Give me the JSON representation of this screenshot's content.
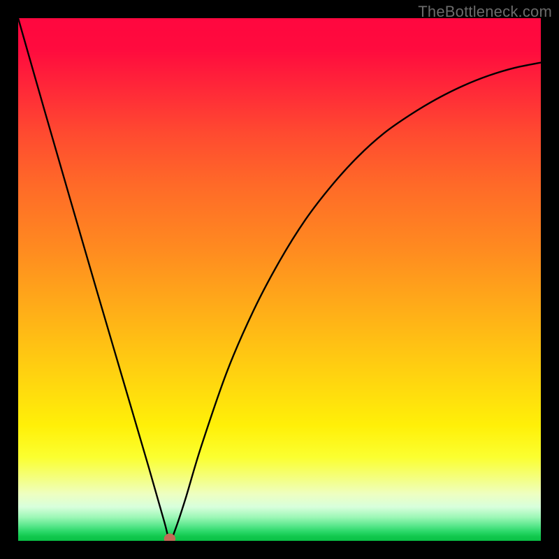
{
  "watermark": "TheBottleneck.com",
  "marker": {
    "u": 0.29,
    "v": 0.0,
    "rx_pct": 0.011,
    "ry_pct": 0.01,
    "color": "#c36a56"
  },
  "chart_data": {
    "type": "line",
    "title": "",
    "xlabel": "",
    "ylabel": "",
    "xlim": [
      0,
      1
    ],
    "ylim": [
      0,
      1
    ],
    "curve": [
      {
        "u": 0.0,
        "v": 1.0
      },
      {
        "u": 0.05,
        "v": 0.825
      },
      {
        "u": 0.1,
        "v": 0.652
      },
      {
        "u": 0.15,
        "v": 0.48
      },
      {
        "u": 0.2,
        "v": 0.31
      },
      {
        "u": 0.25,
        "v": 0.14
      },
      {
        "u": 0.28,
        "v": 0.035
      },
      {
        "u": 0.29,
        "v": 0.0
      },
      {
        "u": 0.3,
        "v": 0.02
      },
      {
        "u": 0.32,
        "v": 0.08
      },
      {
        "u": 0.35,
        "v": 0.18
      },
      {
        "u": 0.4,
        "v": 0.325
      },
      {
        "u": 0.45,
        "v": 0.44
      },
      {
        "u": 0.5,
        "v": 0.535
      },
      {
        "u": 0.55,
        "v": 0.615
      },
      {
        "u": 0.6,
        "v": 0.68
      },
      {
        "u": 0.65,
        "v": 0.735
      },
      {
        "u": 0.7,
        "v": 0.78
      },
      {
        "u": 0.75,
        "v": 0.815
      },
      {
        "u": 0.8,
        "v": 0.845
      },
      {
        "u": 0.85,
        "v": 0.87
      },
      {
        "u": 0.9,
        "v": 0.89
      },
      {
        "u": 0.95,
        "v": 0.905
      },
      {
        "u": 1.0,
        "v": 0.915
      }
    ]
  }
}
